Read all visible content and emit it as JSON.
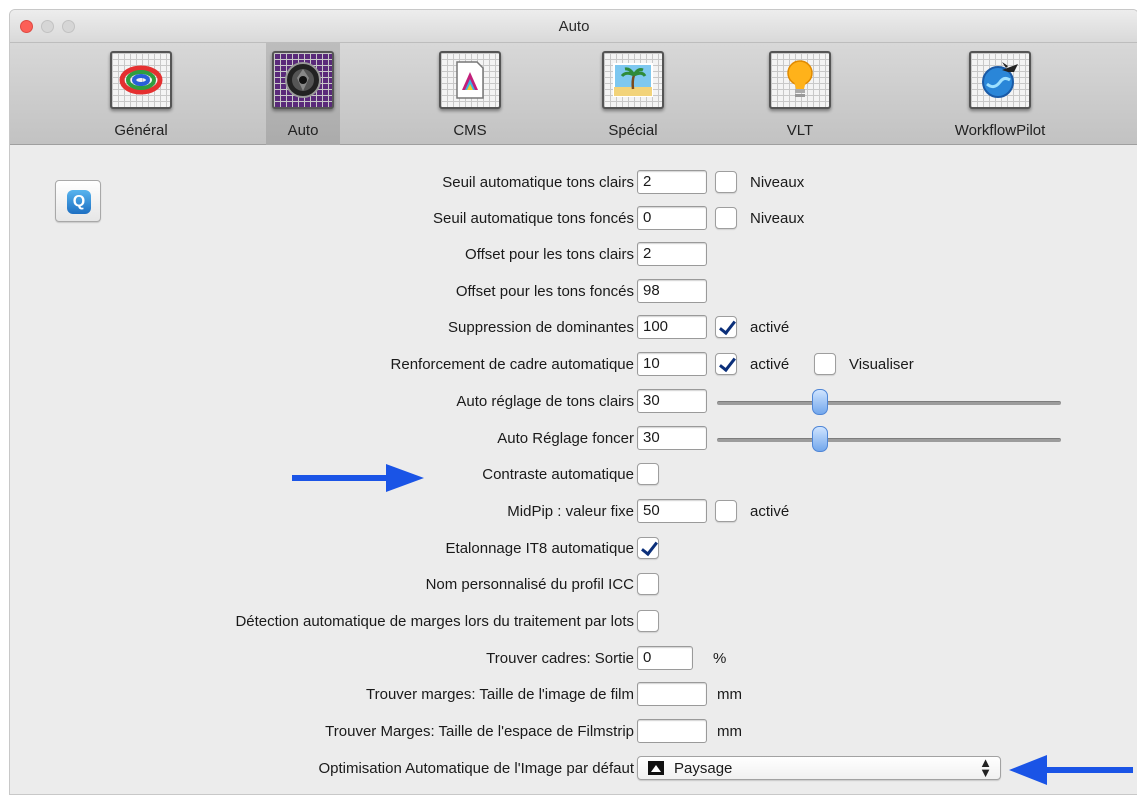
{
  "window": {
    "title": "Auto"
  },
  "toolbar": {
    "items": [
      {
        "label": "Général",
        "icon": "color-wheel-icon",
        "active": false
      },
      {
        "label": "Auto",
        "icon": "aperture-icon",
        "active": true
      },
      {
        "label": "CMS",
        "icon": "color-profile-icon",
        "active": false
      },
      {
        "label": "Spécial",
        "icon": "palm-beach-icon",
        "active": false
      },
      {
        "label": "VLT",
        "icon": "light-bulb-icon",
        "active": false
      },
      {
        "label": "WorkflowPilot",
        "icon": "globe-plane-icon",
        "active": false
      }
    ]
  },
  "help_button": {
    "icon": "quicktime-help-icon",
    "glyph": "Q"
  },
  "settings": {
    "seuil_clairs": {
      "label": "Seuil automatique tons clairs",
      "value": "2",
      "cb_label": "Niveaux",
      "checked": false
    },
    "seuil_fonces": {
      "label": "Seuil automatique tons foncés",
      "value": "0",
      "cb_label": "Niveaux",
      "checked": false
    },
    "offset_clairs": {
      "label": "Offset pour les tons clairs",
      "value": "2"
    },
    "offset_fonces": {
      "label": "Offset pour les tons foncés",
      "value": "98"
    },
    "dominantes": {
      "label": "Suppression de dominantes",
      "value": "100",
      "cb_label": "activé",
      "checked": true
    },
    "cadre": {
      "label": "Renforcement de cadre automatique",
      "value": "10",
      "cb_label": "activé",
      "checked": true,
      "cb2_label": "Visualiser",
      "checked2": false
    },
    "auto_clairs": {
      "label": "Auto réglage de tons clairs",
      "value": "30",
      "slider_fraction": 0.3
    },
    "auto_foncer": {
      "label": "Auto Réglage foncer",
      "value": "30",
      "slider_fraction": 0.3
    },
    "contraste": {
      "label": "Contraste automatique",
      "checked": false
    },
    "midpip": {
      "label": "MidPip : valeur fixe",
      "value": "50",
      "cb_label": "activé",
      "checked": false
    },
    "it8": {
      "label": "Etalonnage IT8 automatique",
      "checked": true
    },
    "icc": {
      "label": "Nom personnalisé du profil ICC",
      "checked": false
    },
    "marges_lots": {
      "label": "Détection automatique de marges lors du traitement par lots",
      "checked": false
    },
    "trouver_cadres": {
      "label": "Trouver cadres: Sortie",
      "value": "0",
      "unit": "%"
    },
    "taille_film": {
      "label": "Trouver marges: Taille de l'image de film",
      "value": "",
      "unit": "mm"
    },
    "taille_filmstrip": {
      "label": "Trouver Marges: Taille de l'espace de Filmstrip",
      "value": "",
      "unit": "mm"
    },
    "optimisation": {
      "label": "Optimisation Automatique de l'Image par défaut",
      "selected": "Paysage",
      "icon": "landscape-icon"
    }
  },
  "annotations": {
    "arrow_color": "#1a54e6"
  }
}
